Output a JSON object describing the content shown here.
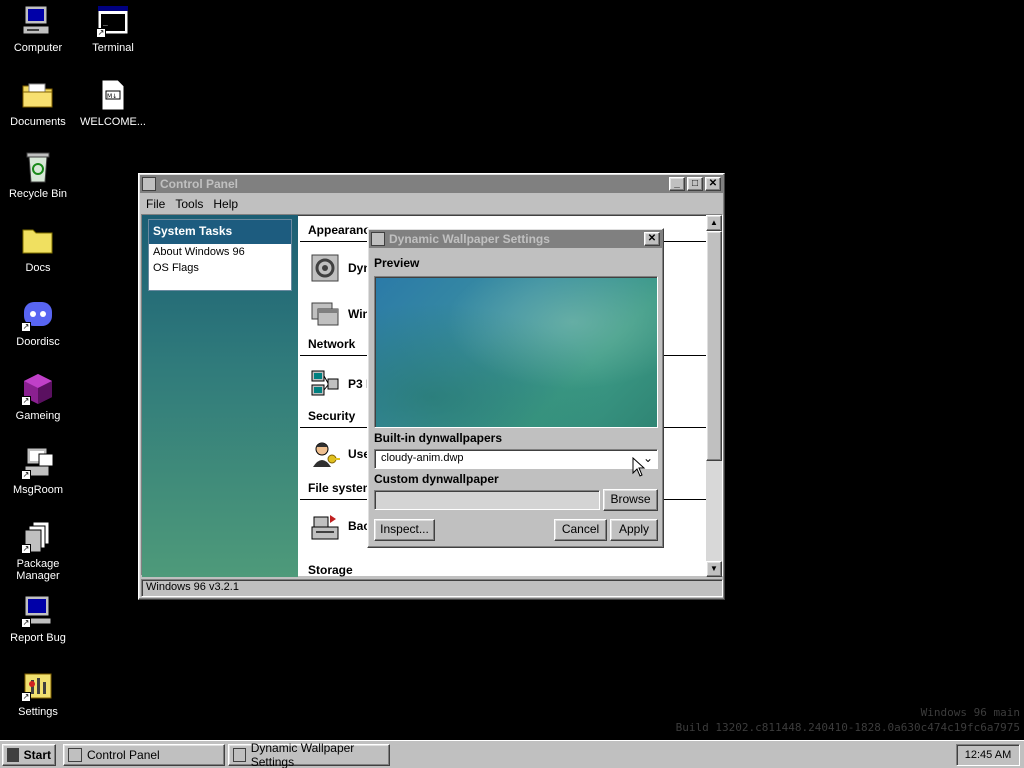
{
  "desktop": {
    "icons": [
      {
        "label": "Computer",
        "icon": "computer-icon"
      },
      {
        "label": "Terminal",
        "icon": "terminal-icon"
      },
      {
        "label": "Documents",
        "icon": "documents-folder-icon"
      },
      {
        "label": "WELCOME...",
        "icon": "markdown-file-icon"
      },
      {
        "label": "Recycle Bin",
        "icon": "recycle-bin-icon"
      },
      {
        "label": "Docs",
        "icon": "folder-icon"
      },
      {
        "label": "Doordisc",
        "icon": "doordisc-icon"
      },
      {
        "label": "Gameing",
        "icon": "gameing-icon"
      },
      {
        "label": "MsgRoom",
        "icon": "msgroom-icon"
      },
      {
        "label": "Package Manager",
        "icon": "package-manager-icon"
      },
      {
        "label": "Report Bug",
        "icon": "report-bug-icon"
      },
      {
        "label": "Settings",
        "icon": "settings-icon"
      }
    ],
    "watermark": {
      "line1": "Windows 96 main",
      "line2": "Build 13202.c811448.240410-1828.0a630c474c19fc6a7975"
    }
  },
  "control_panel": {
    "title": "Control Panel",
    "menu": [
      "File",
      "Tools",
      "Help"
    ],
    "system_tasks": {
      "header": "System Tasks",
      "items": [
        "About Windows 96",
        "OS Flags"
      ]
    },
    "categories": {
      "appearance": "Appearanc",
      "network": "Network",
      "security": "Security",
      "file_system": "File system",
      "storage": "Storage"
    },
    "items": {
      "dyn": "Dyn",
      "win": "Win",
      "p3": "P3 I",
      "use": "Use",
      "bac": "Bac"
    },
    "status": "Windows 96 v3.2.1"
  },
  "dialog": {
    "title": "Dynamic Wallpaper Settings",
    "preview_label": "Preview",
    "builtin_label": "Built-in dynwallpapers",
    "builtin_value": "cloudy-anim.dwp",
    "custom_label": "Custom dynwallpaper",
    "custom_value": "",
    "browse": "Browse",
    "inspect": "Inspect...",
    "cancel": "Cancel",
    "apply": "Apply"
  },
  "taskbar": {
    "start": "Start",
    "tasks": [
      "Control Panel",
      "Dynamic Wallpaper Settings"
    ],
    "clock": "12:45 AM"
  },
  "colors": {
    "desktop": "#000000",
    "face": "#c0c0c0",
    "inactive_title": "#808080",
    "task_header": "#1d5c7f"
  }
}
